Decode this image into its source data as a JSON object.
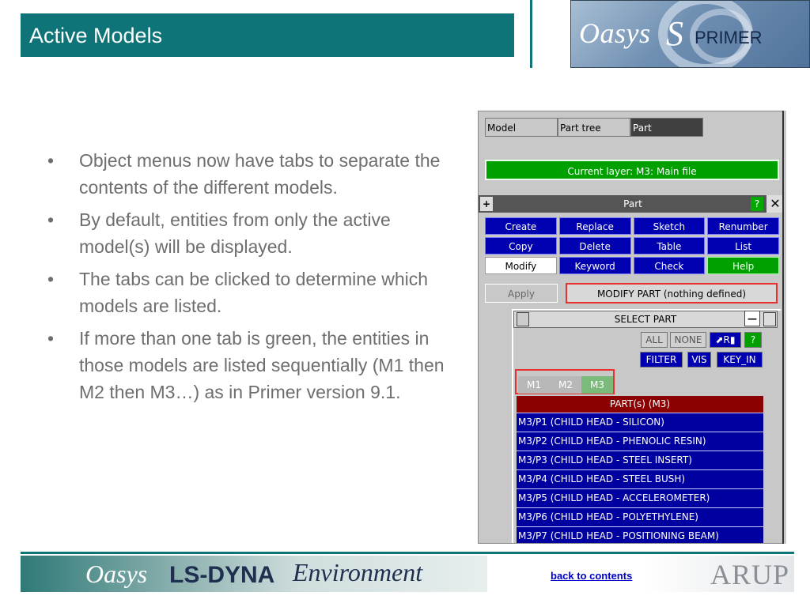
{
  "header": {
    "title": "Active Models",
    "logo": {
      "brand": "Oasys",
      "product": "PRIMER"
    }
  },
  "bullets": [
    "Object menus now have tabs to separate the contents of the different models.",
    "By default, entities from only the active model(s) will be displayed.",
    "The tabs can be clicked to determine which models are listed.",
    "If more than one tab is green, the entities in those models are listed sequentially (M1 then M2 then M3…) as in Primer version 9.1."
  ],
  "screenshot": {
    "tabs": [
      "Model",
      "Part tree",
      "Part"
    ],
    "current_layer": "Current layer: M3: Main file",
    "panel_title": "Part",
    "panel_help": "?",
    "panel_close": "✕",
    "buttons": [
      {
        "label": "Create",
        "style": "blue"
      },
      {
        "label": "Replace",
        "style": "blue"
      },
      {
        "label": "Sketch",
        "style": "blue"
      },
      {
        "label": "Renumber",
        "style": "blue"
      },
      {
        "label": "Copy",
        "style": "blue"
      },
      {
        "label": "Delete",
        "style": "blue"
      },
      {
        "label": "Table",
        "style": "blue"
      },
      {
        "label": "List",
        "style": "blue"
      },
      {
        "label": "Modify",
        "style": "white"
      },
      {
        "label": "Keyword",
        "style": "blue"
      },
      {
        "label": "Check",
        "style": "blue"
      },
      {
        "label": "Help",
        "style": "green"
      }
    ],
    "apply_label": "Apply",
    "modify_status": "MODIFY PART (nothing defined)",
    "select_title": "SELECT PART",
    "small_buttons": {
      "all": "ALL",
      "none": "NONE",
      "r": "R",
      "q": "?",
      "filter": "FILTER",
      "vis": "VIS",
      "keyin": "KEY_IN"
    },
    "model_tabs": [
      {
        "label": "M1",
        "active": false
      },
      {
        "label": "M2",
        "active": false
      },
      {
        "label": "M3",
        "active": true
      }
    ],
    "list_header": "PART(s) (M3)",
    "list_items": [
      "M3/P1 (CHILD HEAD - SILICON)",
      "M3/P2 (CHILD HEAD - PHENOLIC RESIN)",
      "M3/P3 (CHILD HEAD - STEEL INSERT)",
      "M3/P4 (CHILD HEAD - STEEL BUSH)",
      "M3/P5 (CHILD HEAD - ACCELEROMETER)",
      "M3/P6 (CHILD HEAD - POLYETHYLENE)",
      "M3/P7 (CHILD HEAD - POSITIONING BEAM)"
    ]
  },
  "footer": {
    "brand": "Oasys",
    "product": "LS-DYNA",
    "environment": "Environment",
    "link": "back to contents",
    "company": "ARUP"
  },
  "colors": {
    "teal": "#0e7478",
    "ui_blue": "#0000b0",
    "ui_green": "#00a000",
    "ui_red": "#8b0000",
    "highlight_red": "#e83030"
  }
}
